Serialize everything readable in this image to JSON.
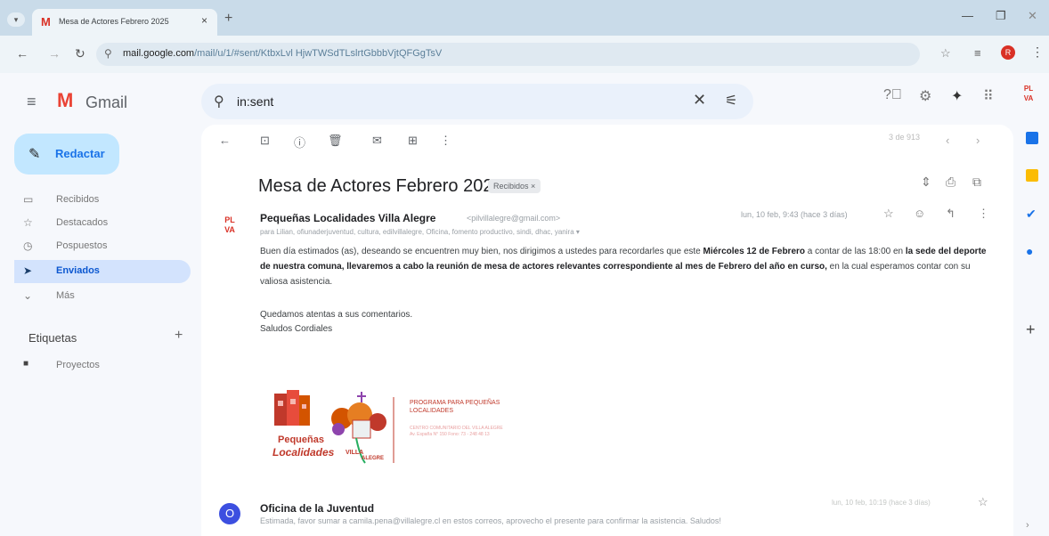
{
  "browser": {
    "tab_title": "Mesa de Actores Febrero 2025",
    "tab_close": "×",
    "new_tab": "+",
    "url_host": "mail.google.com",
    "url_path": "/mail/u/1/#sent/KtbxLvl HjwTWSdTLslrtGbbbVjtQFGgTsV",
    "profile_initial": "R"
  },
  "gmail": {
    "product_name": "Gmail",
    "search_query": "in:sent"
  },
  "sidebar": {
    "compose_label": "Redactar",
    "items": [
      {
        "label": "Recibidos",
        "icon": "inbox-icon"
      },
      {
        "label": "Destacados",
        "icon": "star-icon"
      },
      {
        "label": "Pospuestos",
        "icon": "clock-icon"
      },
      {
        "label": "Enviados",
        "icon": "send-icon"
      },
      {
        "label": "Más",
        "icon": "chevron-down-icon"
      }
    ],
    "labels_header": "Etiquetas",
    "labels": [
      {
        "label": "Proyectos"
      }
    ]
  },
  "toolbar": {
    "pager": "3 de 913"
  },
  "thread": {
    "subject": "Mesa de Actores Febrero 2025",
    "badge": "Recibidos ×",
    "message1": {
      "sender_name": "Pequeñas Localidades Villa Alegre",
      "sender_email": "<pilvillalegre@gmail.com>",
      "recipients": "para Lilian, ofiunaderjuventud, cultura, edilvillalegre, Oficina, fomento productivo, sindi, dhac, yanira ▾",
      "date": "lun, 10 feb, 9:43 (hace 3 días)",
      "body_part1": "Buen día estimados (as), deseando se encuentren muy bien, nos dirigimos a ustedes para recordarles que este ",
      "body_bold1": "Miércoles 12 de Febrero",
      "body_part2": " a contar de las 18:00 en ",
      "body_bold2": "la sede del deporte de nuestra comuna, llevaremos a cabo la reunión de mesa de actores relevantes correspondiente al mes de Febrero del año en curso,",
      "body_part3": " en la cual esperamos contar con su valiosa asistencia.",
      "closing1": "Quedamos atentas a sus comentarios.",
      "closing2": "Saludos Cordiales",
      "signature": {
        "program": "PROGRAMA PARA PEQUEÑAS LOCALIDADES",
        "program_sub": "CENTRO COMUNITARIO DEL VILLA ALEGRE Av. España N° 150 Fono: 73 - 248 48 13",
        "pequenas": "Pequeñas",
        "localidades": "Localidades",
        "villa": "VILLA",
        "alegre": "ALEGRE"
      }
    },
    "message2": {
      "avatar_letter": "O",
      "sender_name": "Oficina de la Juventud",
      "snippet": "Estimada, favor sumar a camila.pena@villalegre.cl en estos correos, aprovecho el presente para confirmar la asistencia. Saludos!",
      "date": "lun, 10 feb, 10:19 (hace 3 días)"
    }
  },
  "colors": {
    "accent": "#0b57d0",
    "compose_bg": "#c2e7ff",
    "selected_nav": "#d3e3fd",
    "gmail_red": "#ea4335"
  }
}
